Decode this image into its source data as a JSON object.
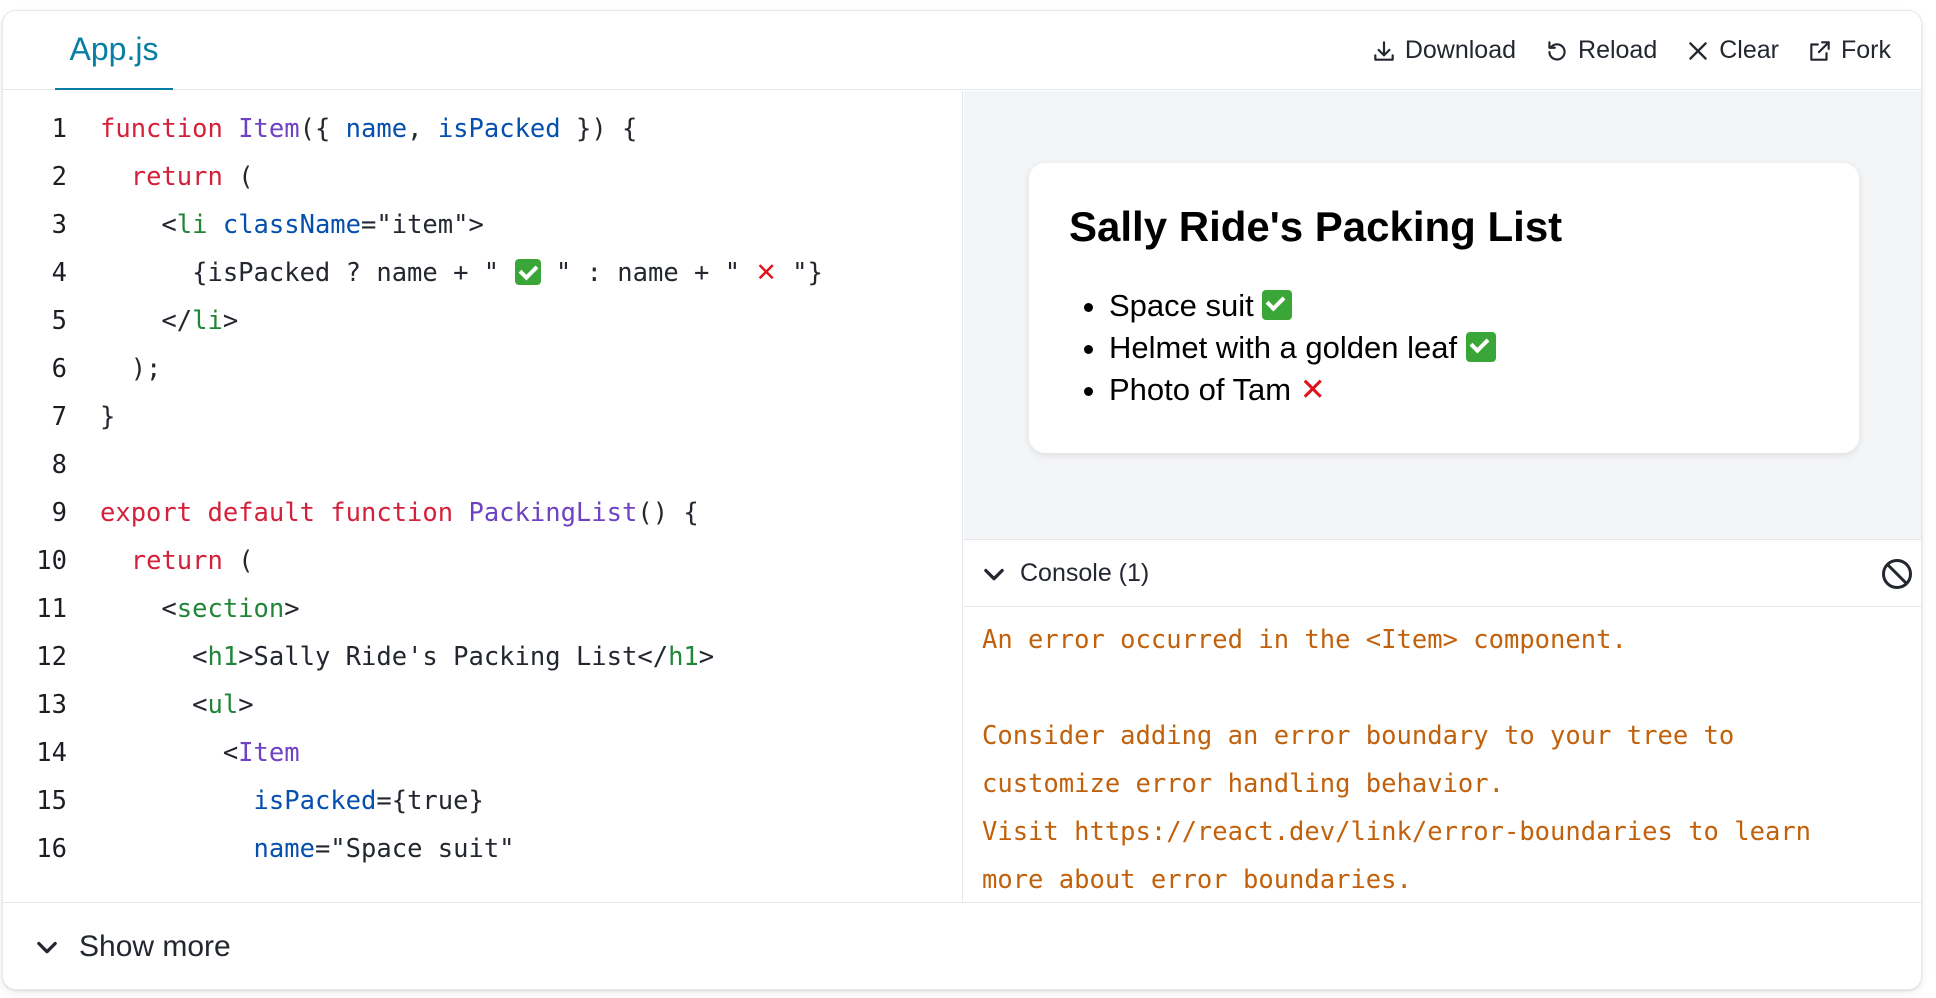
{
  "tab": {
    "label": "App.js"
  },
  "toolbar": {
    "download_label": "Download",
    "reload_label": "Reload",
    "clear_label": "Clear",
    "fork_label": "Fork"
  },
  "editor": {
    "line_numbers": [
      "1",
      "2",
      "3",
      "4",
      "5",
      "6",
      "7",
      "8",
      "9",
      "10",
      "11",
      "12",
      "13",
      "14",
      "15",
      "16"
    ],
    "lines": [
      "function Item({ name, isPacked }) {",
      "  return (",
      "    <li className=\"item\">",
      "      {isPacked ? name + \" ✅ \" : name + \" ❌ \"}",
      "    </li>",
      "  );",
      "}",
      "",
      "export default function PackingList() {",
      "  return (",
      "    <section>",
      "      <h1>Sally Ride's Packing List</h1>",
      "      <ul>",
      "        <Item",
      "          isPacked={true}",
      "          name=\"Space suit\""
    ]
  },
  "preview": {
    "heading": "Sally Ride's Packing List",
    "items": [
      {
        "text": "Space suit",
        "status": "packed"
      },
      {
        "text": "Helmet with a golden leaf",
        "status": "packed"
      },
      {
        "text": "Photo of Tam",
        "status": "not-packed"
      }
    ]
  },
  "console": {
    "title": "Console (1)",
    "lines": [
      "An error occurred in the <Item> component.",
      "",
      "Consider adding an error boundary to your tree to",
      "customize error handling behavior.",
      "Visit https://react.dev/link/error-boundaries to learn",
      "more about error boundaries."
    ]
  },
  "footer": {
    "show_more_label": "Show more"
  },
  "colors": {
    "accent": "#087ea4",
    "keyword": "#d4213b",
    "function_name": "#6f42c1",
    "jsx_tag": "#22863a",
    "attribute": "#0550ae",
    "console_error": "#c2610c"
  }
}
